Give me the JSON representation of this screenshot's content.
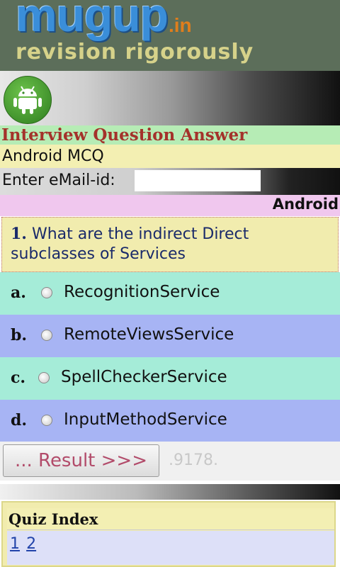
{
  "header": {
    "logo_main": "mugup",
    "logo_tld": ".in",
    "tagline": "revision rigorously"
  },
  "icons": {
    "android": "android-robot-icon",
    "radio": "radio-button-icon"
  },
  "section_title": "Interview Question Answer",
  "section_subtitle": "Android MCQ",
  "email": {
    "label": "Enter eMail-id:",
    "value": ""
  },
  "category": "Android",
  "question": {
    "number": "1.",
    "text": "What are the indirect Direct subclasses of Services"
  },
  "options": [
    {
      "letter": "a.",
      "text": "RecognitionService"
    },
    {
      "letter": "b.",
      "text": "RemoteViewsService"
    },
    {
      "letter": "c.",
      "text": "SpellCheckerService"
    },
    {
      "letter": "d.",
      "text": "InputMethodService"
    }
  ],
  "result": {
    "button_label": "... Result >>>",
    "code": ".9178."
  },
  "quiz_index": {
    "title": "Quiz Index",
    "pages": [
      "1",
      "2"
    ]
  },
  "colors": {
    "title_green": "#b6ecb5",
    "option_teal": "#a5ecd8",
    "option_blue": "#a7b4f4",
    "category_pink": "#f0c7ee",
    "question_yellow": "#f1ecae"
  }
}
